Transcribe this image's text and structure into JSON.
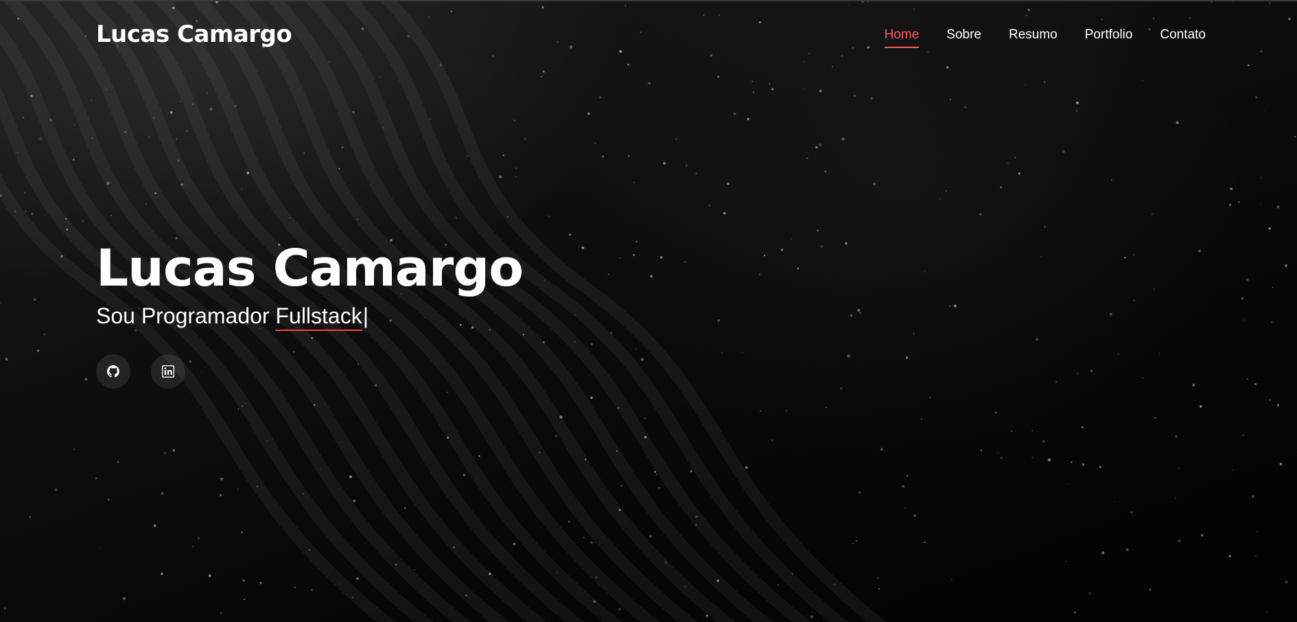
{
  "header": {
    "logo": "Lucas Camargo",
    "nav": [
      {
        "label": "Home",
        "active": true
      },
      {
        "label": "Sobre",
        "active": false
      },
      {
        "label": "Resumo",
        "active": false
      },
      {
        "label": "Portfolio",
        "active": false
      },
      {
        "label": "Contato",
        "active": false
      }
    ]
  },
  "hero": {
    "title": "Lucas Camargo",
    "subtitle_prefix": "Sou Programador ",
    "typed_word": "Fullstack",
    "cursor": "|",
    "socials": [
      {
        "icon": "github-icon"
      },
      {
        "icon": "linkedin-icon"
      }
    ]
  },
  "colors": {
    "accent": "#ff5a5f",
    "underline": "#ff3b3f",
    "text": "#ffffff",
    "background": "#0a0a0a"
  }
}
